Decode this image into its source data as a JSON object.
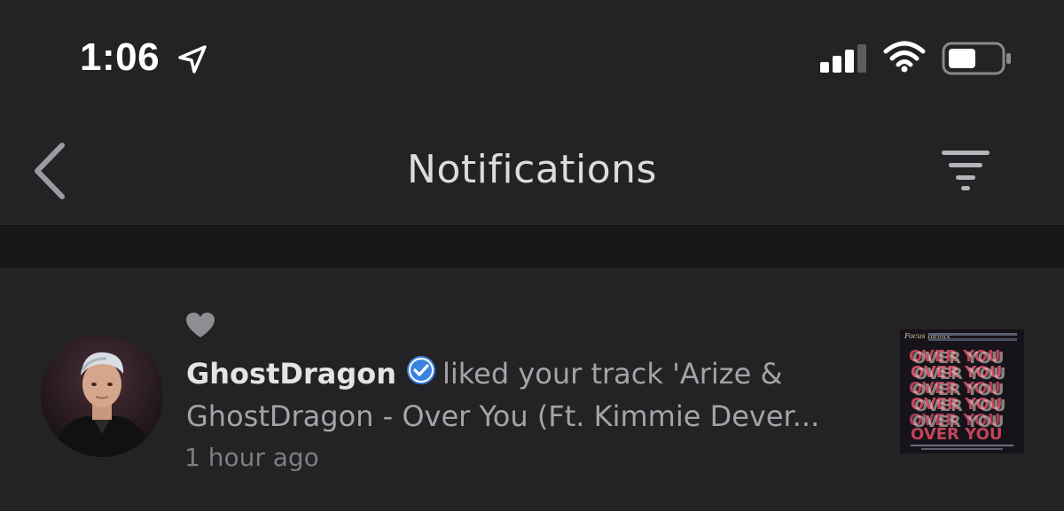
{
  "status_bar": {
    "time": "1:06",
    "icons": [
      "location-arrow-icon",
      "cellular-signal-icon",
      "wifi-icon",
      "battery-icon"
    ]
  },
  "header": {
    "title": "Notifications",
    "back_icon": "chevron-left-icon",
    "filter_icon": "filter-icon"
  },
  "notifications": [
    {
      "type_icon": "heart-icon",
      "user": "GhostDragon",
      "verified": true,
      "message": "liked your track 'Arize & GhostDragon - Over You (Ft. Kimmie Dever...",
      "time": "1 hour ago",
      "artwork": {
        "label_top": "Focus Remix",
        "title_repeated": "OVER YOU"
      }
    }
  ],
  "colors": {
    "background": "#232224",
    "divider": "#18181a",
    "verified": "#3b82e0",
    "text_primary": "#e4e4e6",
    "text_secondary": "#a4a4a8"
  }
}
